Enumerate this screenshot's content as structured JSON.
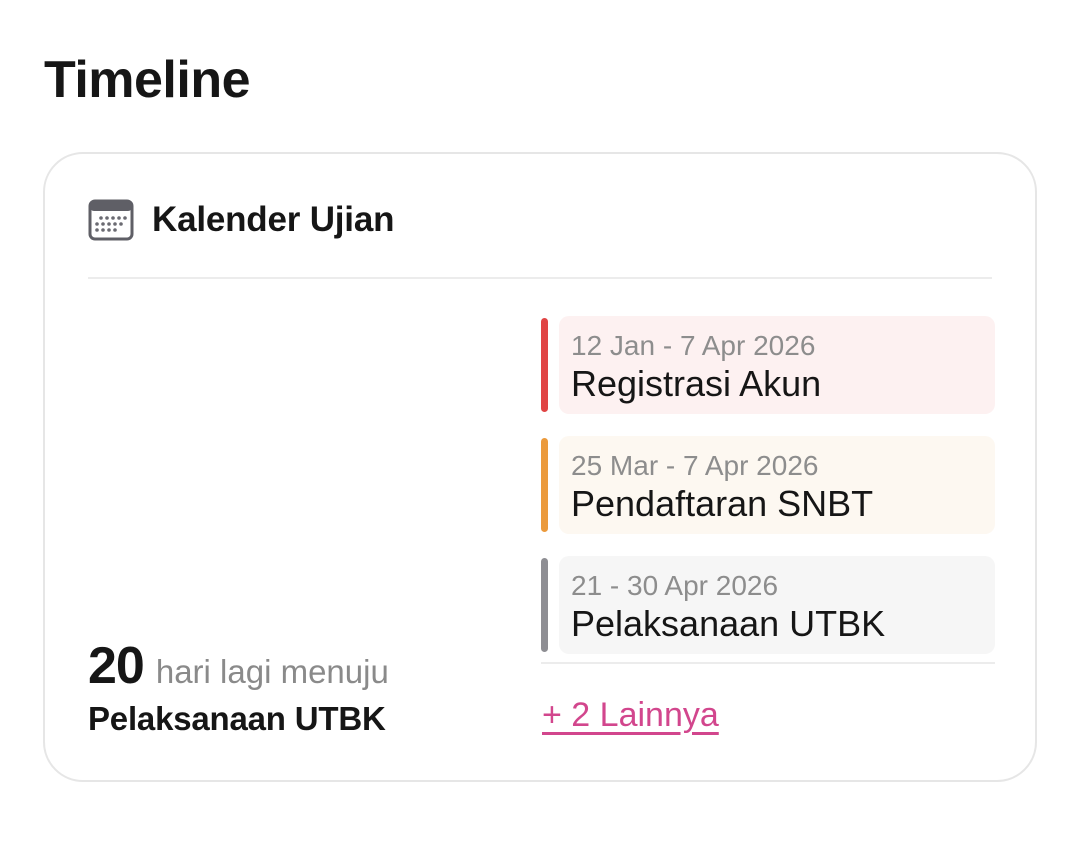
{
  "page": {
    "title": "Timeline"
  },
  "card": {
    "title": "Kalender Ujian",
    "icon": "calendar-icon"
  },
  "countdown": {
    "number": "20",
    "text": "hari lagi menuju",
    "target": "Pelaksanaan UTBK"
  },
  "events": [
    {
      "date": "12 Jan - 7 Apr 2026",
      "name": "Registrasi Akun",
      "accent": "#e04444",
      "bg": "#fdf1f1"
    },
    {
      "date": "25 Mar - 7 Apr 2026",
      "name": "Pendaftaran SNBT",
      "accent": "#eb9a3c",
      "bg": "#fdf8f1"
    },
    {
      "date": "21 - 30 Apr 2026",
      "name": "Pelaksanaan UTBK",
      "accent": "#8e8e93",
      "bg": "#f6f6f6"
    }
  ],
  "more": {
    "label": "+ 2 Lainnya"
  }
}
